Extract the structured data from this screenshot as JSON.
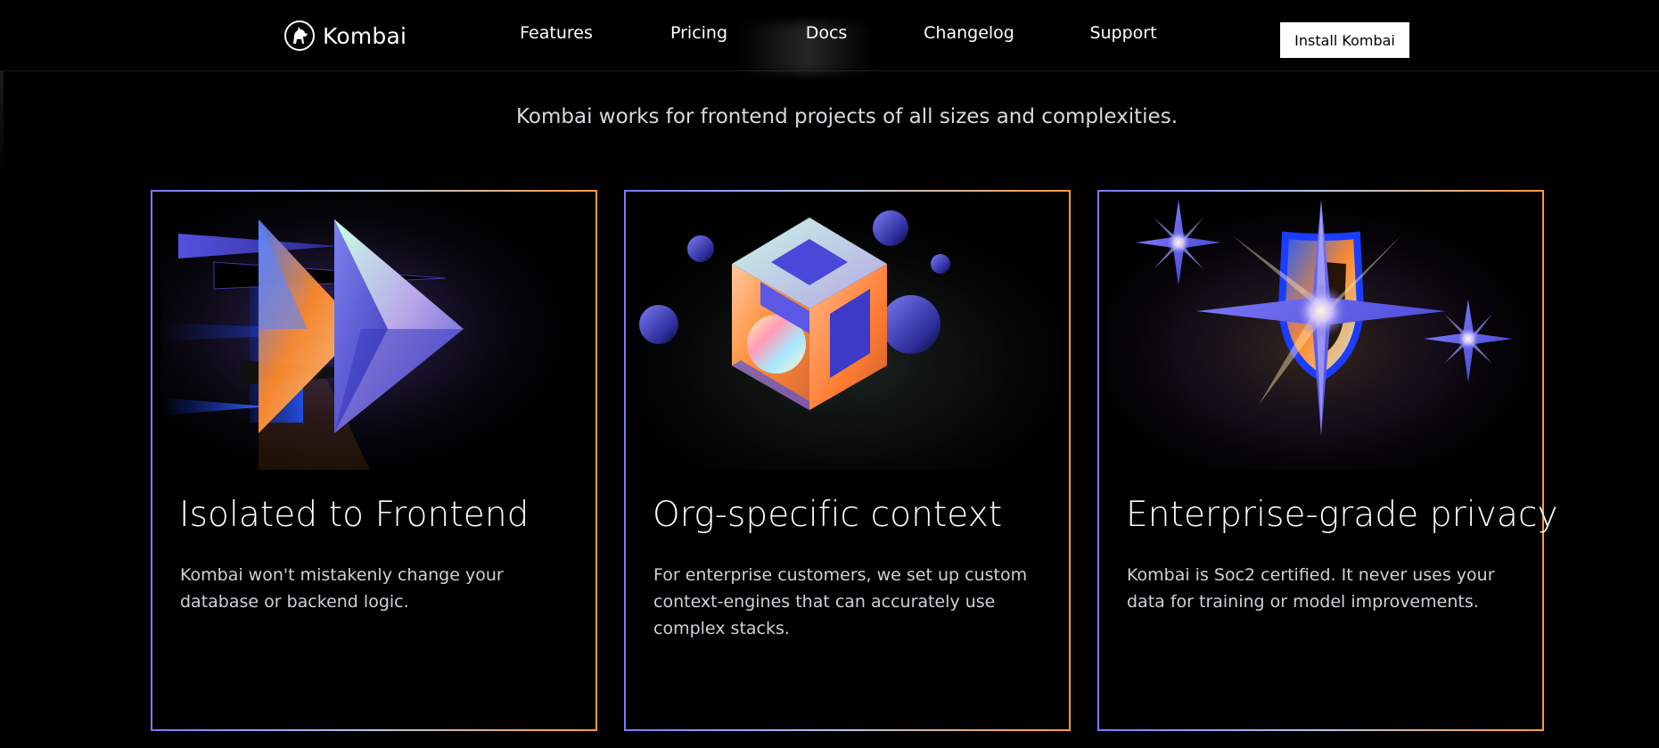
{
  "brand": {
    "name": "Kombai",
    "logo_icon": "dog-logo-icon"
  },
  "nav": {
    "items": [
      {
        "label": "Features"
      },
      {
        "label": "Pricing"
      },
      {
        "label": "Docs"
      },
      {
        "label": "Changelog"
      },
      {
        "label": "Support"
      }
    ],
    "cta_label": "Install Kombai"
  },
  "hero": {
    "tagline": "Kombai works for frontend projects of all sizes and complexities."
  },
  "cards": [
    {
      "title": "Isolated to Frontend",
      "description": "Kombai won't mistakenly change your database or backend logic.",
      "illustration": "arrows-illustration"
    },
    {
      "title": "Org-specific context",
      "description": "For enterprise customers, we set up custom context-engines that can accurately use complex stacks.",
      "illustration": "cube-illustration"
    },
    {
      "title": "Enterprise-grade privacy",
      "description": "Kombai is Soc2 certified. It never uses your data for training or model improvements.",
      "illustration": "shield-stars-illustration"
    }
  ],
  "colors": {
    "background": "#000000",
    "border_start": "#7b79ff",
    "border_end": "#ff9a3d",
    "accent_blue": "#3f3fd4",
    "accent_orange": "#ff8a2b"
  }
}
